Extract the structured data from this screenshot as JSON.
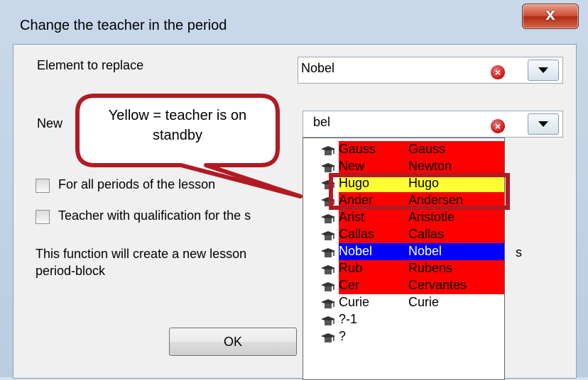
{
  "window": {
    "title": "Change the teacher in the period",
    "close_label": "x"
  },
  "form": {
    "element_label": "Element to replace",
    "element_value": "Nobel",
    "new_label": "New",
    "new_value": "bel",
    "check_all_periods": "For all periods of the lesson",
    "check_qualification": "Teacher with qualification for the s",
    "info_line1": "This function will create a new lesson",
    "info_line1_tail": "s",
    "info_line2": "period-block",
    "ok_label": "OK"
  },
  "callout_text": "Yellow = teacher is on standby",
  "teachers": [
    {
      "short": "Gauss",
      "name": "Gauss",
      "color": "#ff0000"
    },
    {
      "short": "New",
      "name": "Newton",
      "color": "#ff0000"
    },
    {
      "short": "Hugo",
      "name": "Hugo",
      "color": "#ffff33"
    },
    {
      "short": "Ander",
      "name": "Andersen",
      "color": "#ff0000"
    },
    {
      "short": "Arist",
      "name": "Aristotle",
      "color": "#ff0000"
    },
    {
      "short": "Callas",
      "name": "Callas",
      "color": "#ff0000"
    },
    {
      "short": "Nobel",
      "name": "Nobel",
      "color": "#0000ff"
    },
    {
      "short": "Rub",
      "name": "Rubens",
      "color": "#ff0000"
    },
    {
      "short": "Cer",
      "name": "Cervantes",
      "color": "#ff0000"
    },
    {
      "short": "Curie",
      "name": "Curie",
      "color": "#ffffff"
    },
    {
      "short": "?-1",
      "name": "",
      "color": "#ffffff"
    },
    {
      "short": "?",
      "name": "",
      "color": "#ffffff"
    }
  ],
  "icons": {
    "teacher": "mortarboard-icon",
    "clear": "clear-icon",
    "dropdown": "chevron-down-icon"
  }
}
